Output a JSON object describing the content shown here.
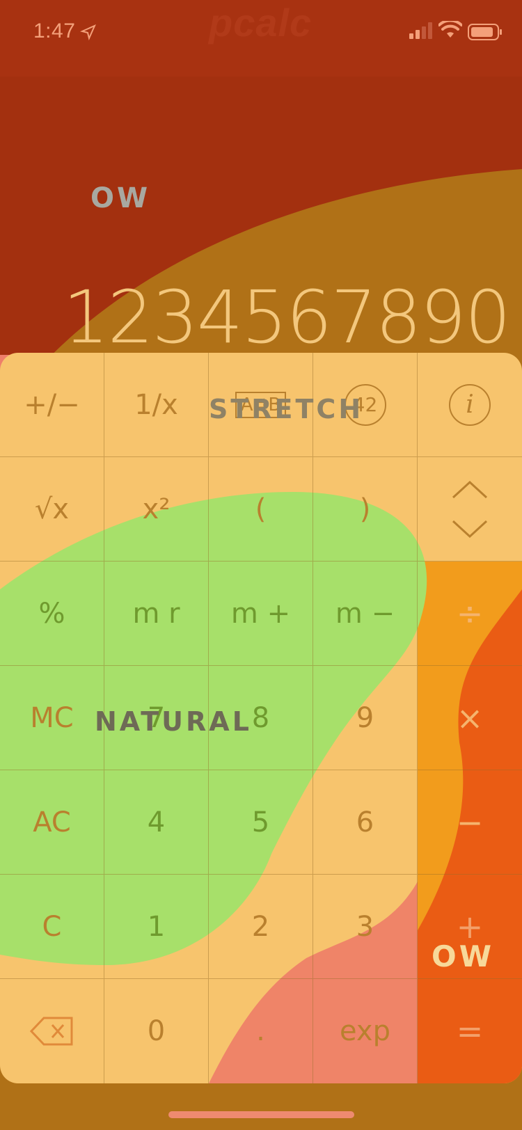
{
  "status_bar": {
    "time": "1:47",
    "location_icon": "location-arrow-icon",
    "signal_icon": "cellular-signal-icon",
    "wifi_icon": "wifi-icon",
    "battery_icon": "battery-icon"
  },
  "brand": "pcalc",
  "overlay_labels": {
    "top": "OW",
    "stretch": "STRETCH",
    "natural": "NATURAL",
    "right": "OW"
  },
  "display": {
    "value": "1234567890"
  },
  "keypad": {
    "rows": [
      [
        "+/−",
        "1/x",
        "A⇄B",
        "42",
        "i"
      ],
      [
        "√x",
        "x²",
        "(",
        ")",
        "up-down"
      ],
      [
        "%",
        "m r",
        "m +",
        "m −",
        "÷"
      ],
      [
        "MC",
        "7",
        "8",
        "9",
        "×"
      ],
      [
        "AC",
        "4",
        "5",
        "6",
        "−"
      ],
      [
        "C",
        "1",
        "2",
        "3",
        "+"
      ],
      [
        "delete",
        "0",
        ".",
        "exp",
        "="
      ]
    ]
  },
  "colors": {
    "background": "#a3300f",
    "keypad_base": "#f7c46d",
    "green_blob": "#a7e06a",
    "orange_operator": "#f29c1c",
    "red_operator": "#ea5c14",
    "pink_blob": "#ef8468"
  }
}
